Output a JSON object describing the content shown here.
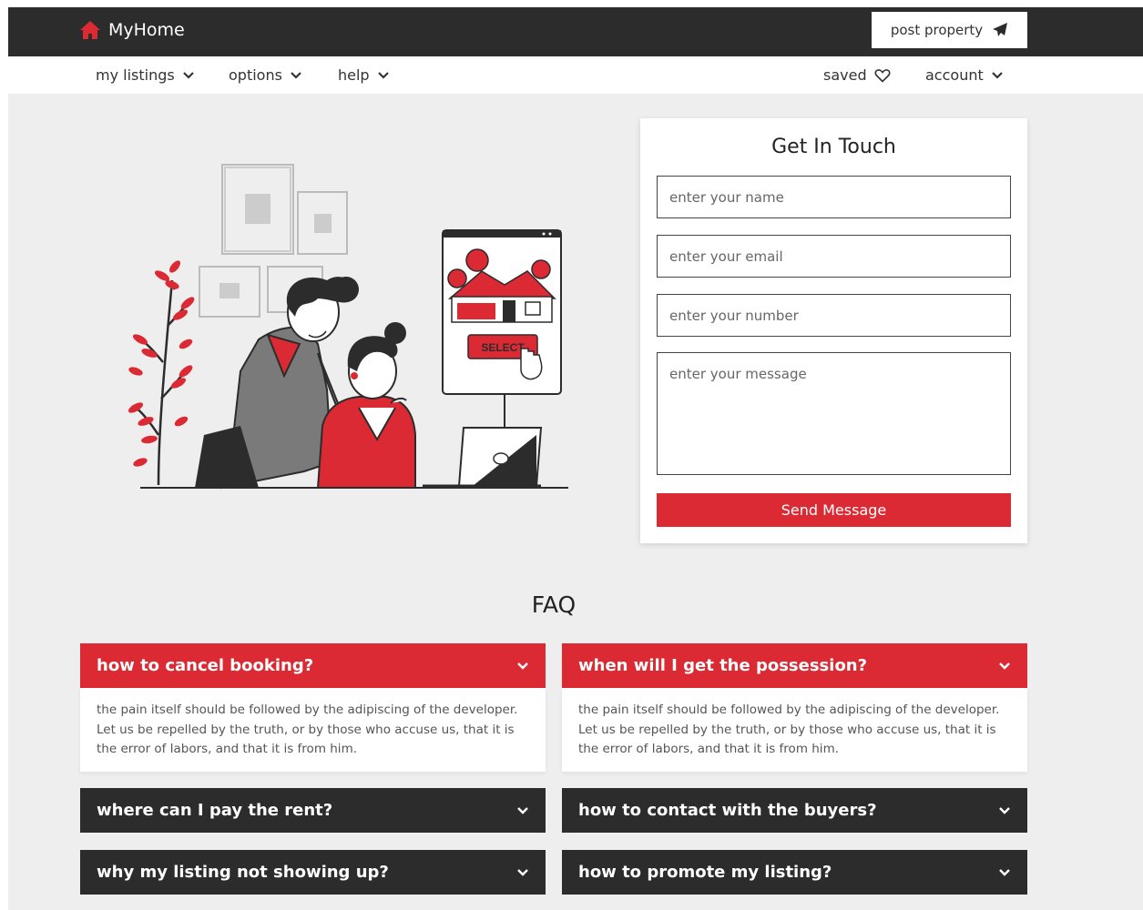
{
  "header": {
    "brand": "MyHome",
    "post_property_label": "post property"
  },
  "nav": {
    "my_listings": "my listings",
    "options": "options",
    "help": "help",
    "saved": "saved",
    "account": "account"
  },
  "contact": {
    "title": "Get In Touch",
    "name_placeholder": "enter your name",
    "email_placeholder": "enter your email",
    "number_placeholder": "enter your number",
    "message_placeholder": "enter your message",
    "send_label": "Send Message"
  },
  "illustration": {
    "select_label": "SELECT"
  },
  "faq": {
    "title": "FAQ",
    "items": [
      {
        "question": "how to cancel booking?",
        "answer": "the pain itself should be followed by the adipiscing of the developer. Let us be repelled by the truth, or by those who accuse us, that it is the error of labors, and that it is from him.",
        "expanded": true
      },
      {
        "question": "when will I get the possession?",
        "answer": "the pain itself should be followed by the adipiscing of the developer. Let us be repelled by the truth, or by those who accuse us, that it is the error of labors, and that it is from him.",
        "expanded": true
      },
      {
        "question": "where can I pay the rent?",
        "expanded": false
      },
      {
        "question": "how to contact with the buyers?",
        "expanded": false
      },
      {
        "question": "why my listing not showing up?",
        "expanded": false
      },
      {
        "question": "how to promote my listing?",
        "expanded": false
      }
    ]
  },
  "colors": {
    "accent": "#db2a33",
    "dark": "#2c2c2c",
    "background": "#eeeeee"
  }
}
